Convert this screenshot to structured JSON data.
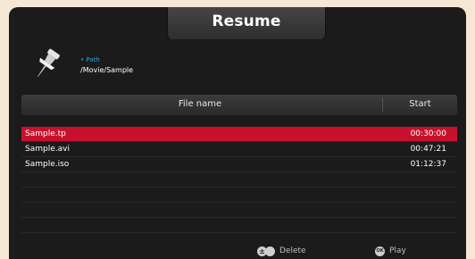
{
  "dialog": {
    "title": "Resume",
    "path_label": "• Path",
    "path_value": "/Movie/Sample"
  },
  "table": {
    "columns": [
      "File name",
      "Start"
    ],
    "rows": [
      {
        "name": "Sample.tp",
        "start": "00:30:00",
        "selected": true
      },
      {
        "name": "Sample.avi",
        "start": "00:47:21",
        "selected": false
      },
      {
        "name": "Sample.iso",
        "start": "01:12:37",
        "selected": false
      }
    ],
    "empty_rows": 5
  },
  "footer": {
    "delete": {
      "icon": "plus-minus-button-icon",
      "glyph": "±",
      "label": "Delete"
    },
    "play": {
      "icon": "ok-button-icon",
      "glyph": "OK",
      "label": "Play"
    }
  },
  "colors": {
    "selection": "#c8112c",
    "path_label": "#2aa3df",
    "background": "#1b1b1b"
  }
}
